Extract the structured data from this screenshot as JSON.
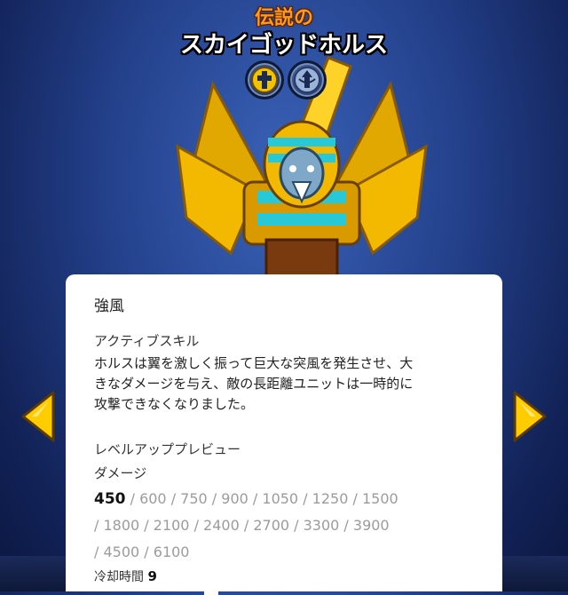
{
  "hero": {
    "rarity": "伝説の",
    "name": "スカイゴッドホルス",
    "class_icon": "cross-icon",
    "element_icon": "wind-emblem-icon"
  },
  "skill": {
    "name": "強風",
    "type": "アクティブスキル",
    "description_lines": [
      "ホルスは翼を激しく振って巨大な突風を発生させ、大",
      "きなダメージを与え、敵の長距離ユニットは一時的に",
      "攻撃できなくなりました。"
    ],
    "preview_label": "レベルアッププレビュー",
    "stat_label": "ダメージ",
    "current_value": "450",
    "level_values": [
      "600",
      "750",
      "900",
      "1050",
      "1250",
      "1500",
      "1800",
      "2100",
      "2400",
      "2700",
      "3300",
      "3900",
      "4500",
      "6100"
    ],
    "cooldown_label": "冷却時間",
    "cooldown_value": "9"
  },
  "nav": {
    "prev_icon": "chevron-left-icon",
    "next_icon": "chevron-right-icon"
  },
  "colors": {
    "rarity_orange": "#ff9a1c",
    "arrow_yellow": "#ffcc00",
    "gold": "#f2b900",
    "turquoise": "#27c8d8"
  }
}
